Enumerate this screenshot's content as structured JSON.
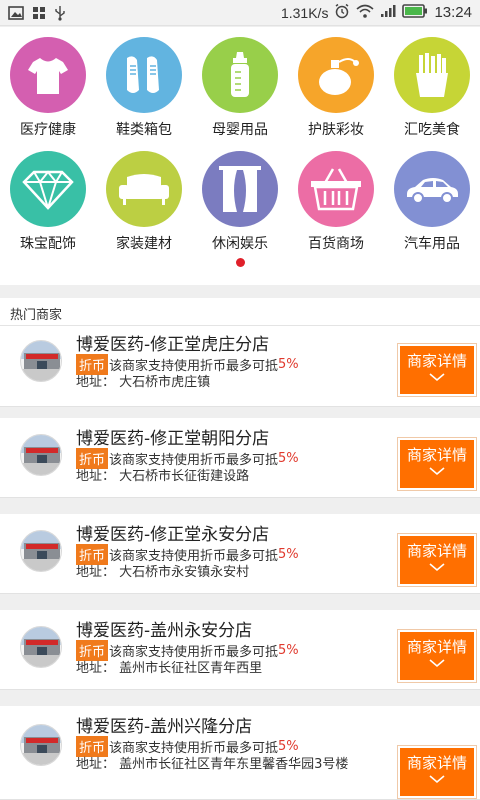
{
  "status_bar": {
    "net_speed": "1.31K/s",
    "time": "13:24",
    "icons": [
      "image-icon",
      "grid-icon",
      "usb-icon",
      "alarm-icon",
      "wifi-icon",
      "signal-icon",
      "battery-icon"
    ]
  },
  "categories": [
    {
      "label": "医疗健康",
      "icon": "tshirt-icon",
      "color": "#d45fb0"
    },
    {
      "label": "鞋类箱包",
      "icon": "shoes-icon",
      "color": "#62b4e0"
    },
    {
      "label": "母婴用品",
      "icon": "baby-bottle-icon",
      "color": "#98cf4a"
    },
    {
      "label": "护肤彩妆",
      "icon": "perfume-icon",
      "color": "#f6a52a"
    },
    {
      "label": "汇吃美食",
      "icon": "fries-icon",
      "color": "#c6d536"
    },
    {
      "label": "珠宝配饰",
      "icon": "diamond-icon",
      "color": "#39c0a6"
    },
    {
      "label": "家装建材",
      "icon": "sofa-icon",
      "color": "#bccf43"
    },
    {
      "label": "休闲娱乐",
      "icon": "curtain-icon",
      "color": "#7b7cc0"
    },
    {
      "label": "百货商场",
      "icon": "basket-icon",
      "color": "#ec6da5"
    },
    {
      "label": "汽车用品",
      "icon": "car-icon",
      "color": "#8290d3"
    }
  ],
  "section_title": "热门商家",
  "coin_tag": "折币",
  "detail_label": "商家详情",
  "merchants": [
    {
      "name": "博爱医药-修正堂虎庄分店",
      "promo_text": "该商家支持使用折币最多可抵",
      "percent": "5%",
      "address": "地址：   大石桥市虎庄镇"
    },
    {
      "name": "博爱医药-修正堂朝阳分店",
      "promo_text": "该商家支持使用折币最多可抵",
      "percent": "5%",
      "address": "地址：   大石桥市长征街建设路"
    },
    {
      "name": "博爱医药-修正堂永安分店",
      "promo_text": "该商家支持使用折币最多可抵",
      "percent": "5%",
      "address": "地址：   大石桥市永安镇永安村"
    },
    {
      "name": "博爱医药-盖州永安分店",
      "promo_text": "该商家支持使用折币最多可抵",
      "percent": "5%",
      "address": "地址：   盖州市长征社区青年西里"
    },
    {
      "name": "博爱医药-盖州兴隆分店",
      "promo_text": "该商家支持使用折币最多可抵",
      "percent": "5%",
      "address": "地址：   盖州市长征社区青年东里馨香华园3号楼"
    }
  ]
}
